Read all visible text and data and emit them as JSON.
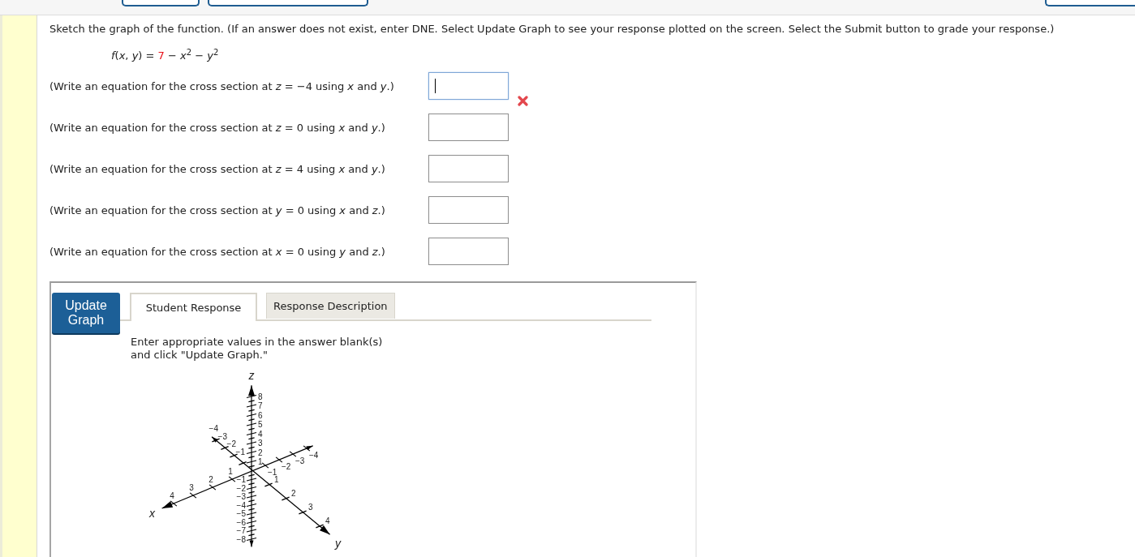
{
  "toolbar": {
    "buttons": [
      {
        "kind": "short"
      },
      {
        "kind": "long"
      },
      {
        "kind": "edge"
      }
    ]
  },
  "question": {
    "instructions": "Sketch the graph of the function. (If an answer does not exist, enter DNE. Select Update Graph to see your response plotted on the screen. Select the Submit button to grade your response.)",
    "function": [
      {
        "text": "*f*(*x*, *y*) =",
        "highlighted": false
      },
      {
        "text": "7",
        "highlighted": true
      },
      {
        "text": "− *x*$^{2}$ − *y*$^{2}$",
        "highlighted": false
      }
    ],
    "parts": [
      {
        "prompt": "(Write an equation for the cross section at *z* = −4 using *x* and *y*.)",
        "focused": true,
        "incorrect": true
      },
      {
        "prompt": "(Write an equation for the cross section at *z* = 0 using *x* and *y*.)",
        "focused": false,
        "incorrect": false
      },
      {
        "prompt": "(Write an equation for the cross section at *z* = 4 using *x* and *y*.)",
        "focused": false,
        "incorrect": false
      },
      {
        "prompt": "(Write an equation for the cross section at *y* = 0 using *x* and *z*.)",
        "focused": false,
        "incorrect": false
      },
      {
        "prompt": "(Write an equation for the cross section at *x* = 0 using *y* and *z*.)",
        "focused": false,
        "incorrect": false
      }
    ]
  },
  "graph_panel": {
    "update_button": "Update Graph",
    "tabs": [
      {
        "label": "Student Response",
        "selected": true
      },
      {
        "label": "Response Description",
        "selected": false
      }
    ],
    "message": "Enter appropriate values in the answer blank(s) and click \"Update Graph.\"",
    "axes": [
      {
        "label": "z",
        "positive_ticks": [
          "8",
          "7",
          "6",
          "5",
          "4",
          "3",
          "2",
          "1"
        ],
        "negative_ticks": [
          "−1",
          "−2",
          "−3",
          "−4",
          "−5",
          "−6",
          "−7",
          "−8"
        ]
      },
      {
        "label": "x",
        "positive_ticks": [
          "1",
          "2",
          "3",
          "4"
        ],
        "negative_ticks": [
          "−1",
          "−2",
          "−3",
          "−4"
        ]
      },
      {
        "label": "y",
        "positive_ticks": [
          "1",
          "2",
          "3",
          "4"
        ],
        "negative_ticks": [
          "−1",
          "−2",
          "−3",
          "−4"
        ]
      }
    ]
  }
}
